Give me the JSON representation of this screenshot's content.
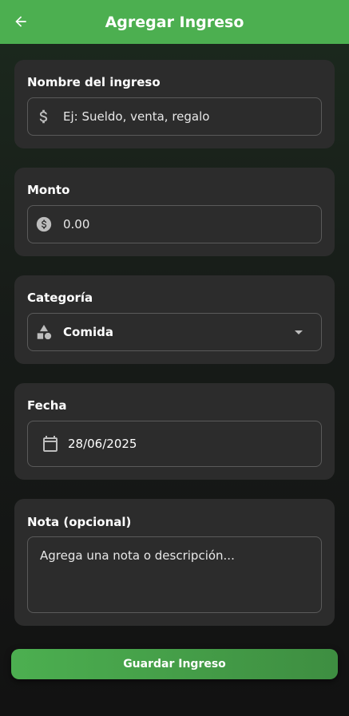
{
  "header": {
    "title": "Agregar Ingreso",
    "back_icon": "arrow-back-icon",
    "color": "#4caf50"
  },
  "fields": {
    "name": {
      "label": "Nombre del ingreso",
      "placeholder": "Ej: Sueldo, venta, regalo",
      "icon": "dollar-icon"
    },
    "amount": {
      "label": "Monto",
      "placeholder": "0.00",
      "icon": "coin-icon"
    },
    "category": {
      "label": "Categoría",
      "value": "Comida",
      "icon": "category-shapes-icon"
    },
    "date": {
      "label": "Fecha",
      "value": "28/06/2025",
      "icon": "calendar-icon"
    },
    "note": {
      "label": "Nota (opcional)",
      "placeholder": "Agrega una nota o descripción..."
    }
  },
  "actions": {
    "save_label": "Guardar Ingreso"
  },
  "colors": {
    "accent": "#4caf50",
    "card": "#2c2c2c",
    "border": "#5a5a5a"
  }
}
